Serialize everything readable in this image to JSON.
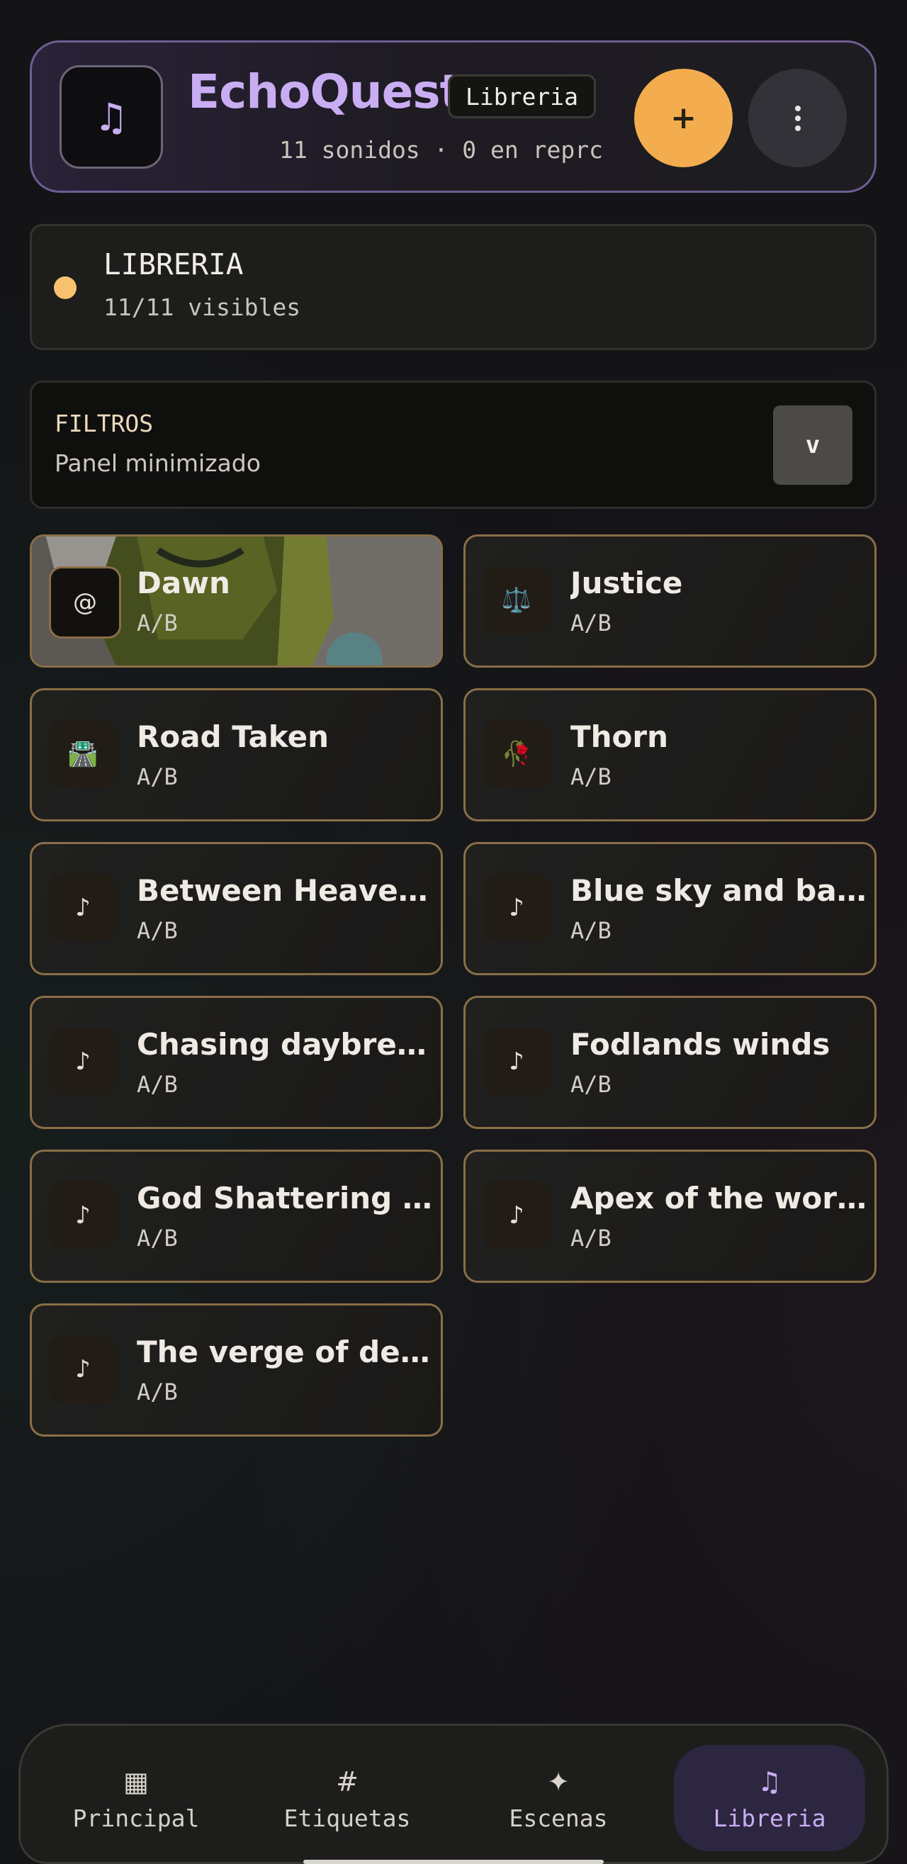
{
  "header": {
    "app_icon": "music-note-icon",
    "app_icon_glyph": "♫",
    "title": "EchoQuest",
    "badge": "Libreria",
    "subtitle": "11 sonidos · 0 en reprc",
    "add_label": "+",
    "more_icon": "kebab-menu-icon"
  },
  "status": {
    "title": "LIBRERIA",
    "subtitle": "11/11 visibles",
    "dot_color": "#f8c26f"
  },
  "filters": {
    "title": "FILTROS",
    "subtitle": "Panel minimizado",
    "toggle_label": "v"
  },
  "sounds": [
    {
      "title": "Dawn",
      "sub": "A/B",
      "icon": "@",
      "icon_name": "at-sign-icon",
      "has_art": true
    },
    {
      "title": "Justice",
      "sub": "A/B",
      "icon": "⚖️",
      "icon_name": "scales-icon"
    },
    {
      "title": "Road Taken",
      "sub": "A/B",
      "icon": "🛣️",
      "icon_name": "road-icon"
    },
    {
      "title": "Thorn",
      "sub": "A/B",
      "icon": "🥀",
      "icon_name": "wilted-rose-icon"
    },
    {
      "title": "Between Heaven a...",
      "sub": "A/B",
      "icon": "♪",
      "icon_name": "music-note-icon"
    },
    {
      "title": "Blue sky and battle",
      "sub": "A/B",
      "icon": "♪",
      "icon_name": "music-note-icon"
    },
    {
      "title": "Chasing daybreak",
      "sub": "A/B",
      "icon": "♪",
      "icon_name": "music-note-icon"
    },
    {
      "title": "Fodlands winds",
      "sub": "A/B",
      "icon": "♪",
      "icon_name": "music-note-icon"
    },
    {
      "title": "God Shattering Star",
      "sub": "A/B",
      "icon": "♪",
      "icon_name": "music-note-icon"
    },
    {
      "title": "Apex of the world",
      "sub": "A/B",
      "icon": "♪",
      "icon_name": "music-note-icon"
    },
    {
      "title": "The verge of death",
      "sub": "A/B",
      "icon": "♪",
      "icon_name": "music-note-icon"
    }
  ],
  "nav": [
    {
      "label": "Principal",
      "icon": "▦",
      "icon_name": "grid-icon",
      "active": false
    },
    {
      "label": "Etiquetas",
      "icon": "#",
      "icon_name": "hashtag-icon",
      "active": false
    },
    {
      "label": "Escenas",
      "icon": "✦",
      "icon_name": "sparkle-icon",
      "active": false
    },
    {
      "label": "Libreria",
      "icon": "♫",
      "icon_name": "music-note-icon",
      "active": true
    }
  ],
  "colors": {
    "accent": "#c9adf2",
    "add_button": "#f3ad4e",
    "card_border": "#8a6e47"
  }
}
